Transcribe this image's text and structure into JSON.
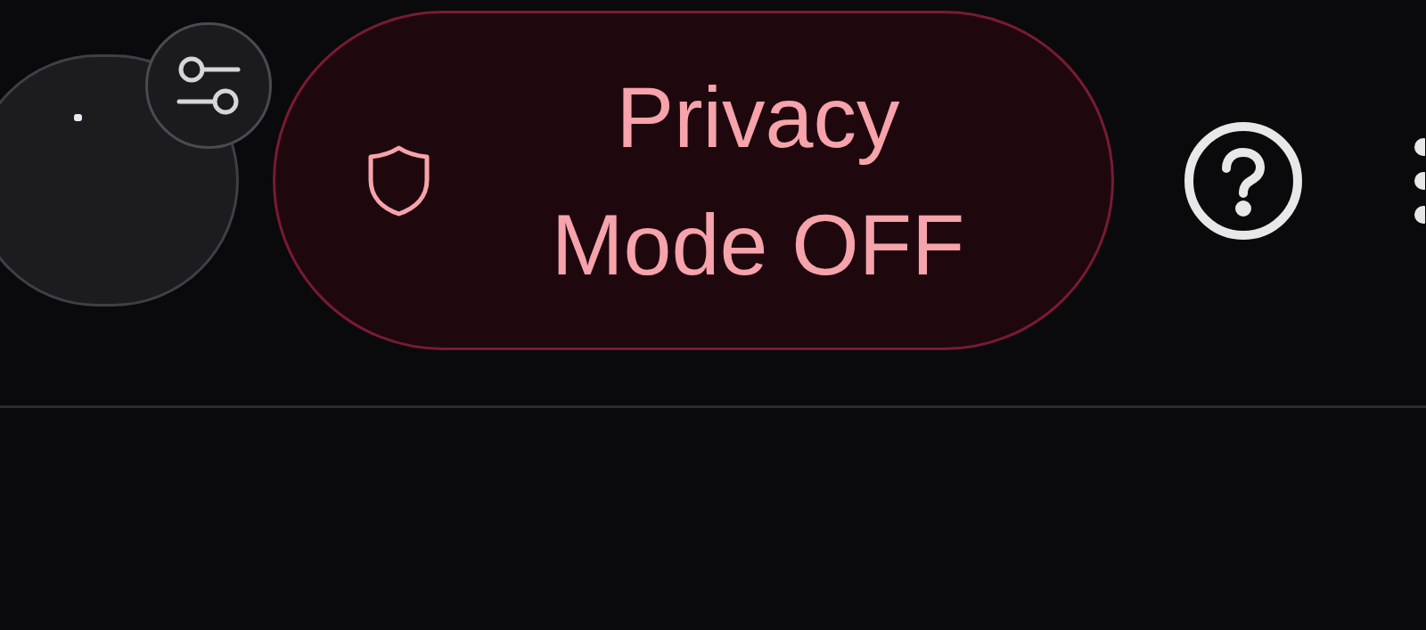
{
  "privacy_toggle": {
    "label": "Privacy Mode OFF",
    "on": false
  }
}
